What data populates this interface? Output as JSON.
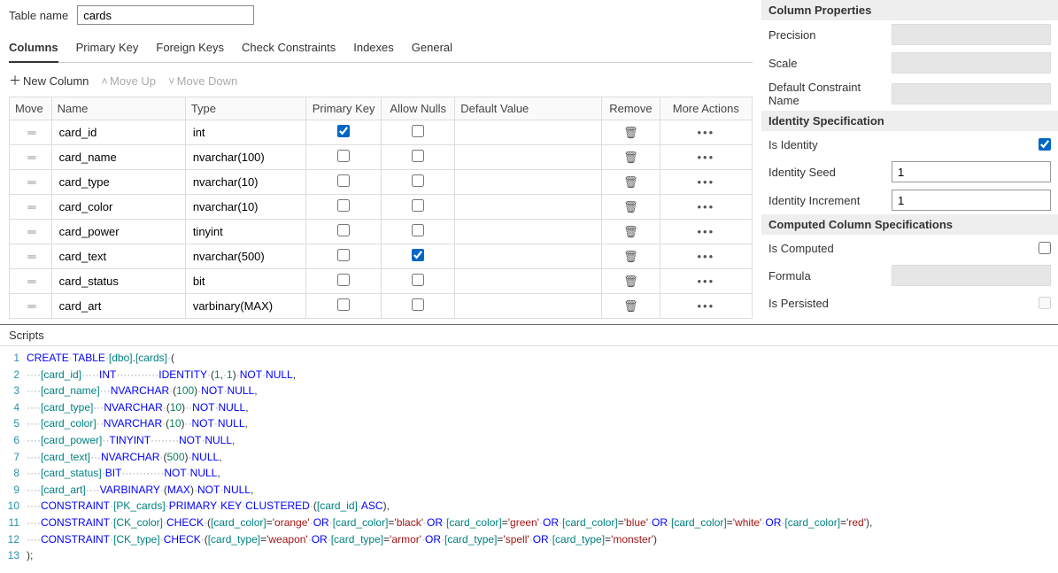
{
  "tableNameLabel": "Table name",
  "tableName": "cards",
  "tabs": [
    "Columns",
    "Primary Key",
    "Foreign Keys",
    "Check Constraints",
    "Indexes",
    "General"
  ],
  "activeTab": 0,
  "toolbar": {
    "newColumn": "New Column",
    "moveUp": "Move Up",
    "moveDown": "Move Down"
  },
  "gridHeaders": {
    "move": "Move",
    "name": "Name",
    "type": "Type",
    "pk": "Primary Key",
    "nulls": "Allow Nulls",
    "def": "Default Value",
    "remove": "Remove",
    "more": "More Actions"
  },
  "columns": [
    {
      "name": "card_id",
      "type": "int",
      "pk": true,
      "nulls": false
    },
    {
      "name": "card_name",
      "type": "nvarchar(100)",
      "pk": false,
      "nulls": false
    },
    {
      "name": "card_type",
      "type": "nvarchar(10)",
      "pk": false,
      "nulls": false
    },
    {
      "name": "card_color",
      "type": "nvarchar(10)",
      "pk": false,
      "nulls": false
    },
    {
      "name": "card_power",
      "type": "tinyint",
      "pk": false,
      "nulls": false
    },
    {
      "name": "card_text",
      "type": "nvarchar(500)",
      "pk": false,
      "nulls": true
    },
    {
      "name": "card_status",
      "type": "bit",
      "pk": false,
      "nulls": false
    },
    {
      "name": "card_art",
      "type": "varbinary(MAX)",
      "pk": false,
      "nulls": false
    }
  ],
  "props": {
    "columnPropertiesTitle": "Column Properties",
    "precision": "Precision",
    "scale": "Scale",
    "defaultConstraint": "Default Constraint Name",
    "identityTitle": "Identity Specification",
    "isIdentity": "Is Identity",
    "isIdentityValue": true,
    "identitySeed": "Identity Seed",
    "identitySeedValue": "1",
    "identityIncrement": "Identity Increment",
    "identityIncrementValue": "1",
    "computedTitle": "Computed Column Specifications",
    "isComputed": "Is Computed",
    "isComputedValue": false,
    "formula": "Formula",
    "isPersisted": "Is Persisted",
    "isPersistedValue": false
  },
  "scriptsTitle": "Scripts",
  "script": [
    "CREATE TABLE [dbo].[cards] (",
    "    [card_id]     INT            IDENTITY (1, 1) NOT NULL,",
    "    [card_name]   NVARCHAR (100) NOT NULL,",
    "    [card_type]   NVARCHAR (10)  NOT NULL,",
    "    [card_color]  NVARCHAR (10)  NOT NULL,",
    "    [card_power]  TINYINT        NOT NULL,",
    "    [card_text]   NVARCHAR (500) NULL,",
    "    [card_status] BIT            NOT NULL,",
    "    [card_art]    VARBINARY (MAX) NOT NULL,",
    "    CONSTRAINT [PK_cards] PRIMARY KEY CLUSTERED ([card_id] ASC),",
    "    CONSTRAINT [CK_color] CHECK ([card_color]='orange' OR [card_color]='black' OR [card_color]='green' OR [card_color]='blue' OR [card_color]='white' OR [card_color]='red'),",
    "    CONSTRAINT [CK_type] CHECK ([card_type]='weapon' OR [card_type]='armor' OR [card_type]='spell' OR [card_type]='monster')",
    ");"
  ]
}
